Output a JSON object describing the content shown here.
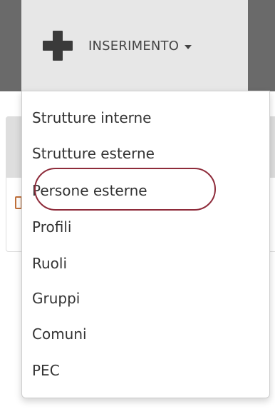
{
  "navbar": {
    "active_item": {
      "icon": "plus-icon",
      "label": "INSERIMENTO"
    }
  },
  "dropdown": {
    "items": [
      {
        "label": "Strutture interne"
      },
      {
        "label": "Strutture esterne"
      },
      {
        "label": "Persone esterne",
        "highlighted": true
      },
      {
        "label": "Profili"
      },
      {
        "label": "Ruoli"
      },
      {
        "label": "Gruppi"
      },
      {
        "label": "Comuni"
      },
      {
        "label": "PEC"
      }
    ]
  },
  "colors": {
    "navbar": "#6b6b6b",
    "nav_item_bg": "#e7e7e7",
    "highlight_ring": "#8e2b3a",
    "text": "#333333"
  }
}
